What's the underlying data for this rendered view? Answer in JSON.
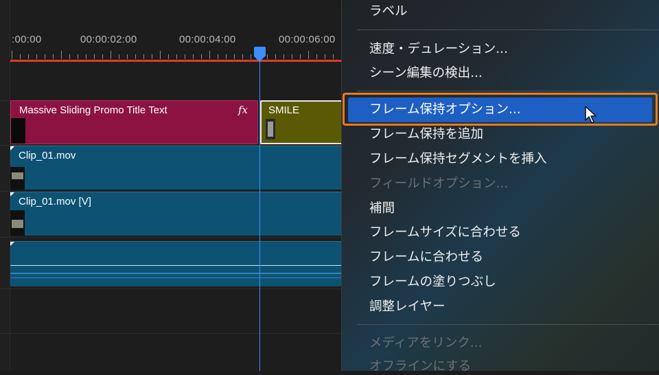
{
  "timeline": {
    "ruler_timecodes": [
      ":00:00",
      "00:00:02:00",
      "00:00:04:00",
      "00:00:06:00"
    ],
    "clips": {
      "graphic_title": "Massive Sliding Promo Title Text",
      "graphic_fx": "fx",
      "smile_title": "SMILE",
      "video1_title": "Clip_01.mov",
      "video2_title": "Clip_01.mov [V]"
    }
  },
  "context_menu": {
    "items": [
      {
        "label": "ラベル",
        "enabled": true
      },
      {
        "label": "速度・デュレーション...",
        "enabled": true
      },
      {
        "label": "シーン編集の検出...",
        "enabled": true
      },
      {
        "label": "フレーム保持オプション...",
        "enabled": true,
        "selected": true
      },
      {
        "label": "フレーム保持を追加",
        "enabled": true
      },
      {
        "label": "フレーム保持セグメントを挿入",
        "enabled": true
      },
      {
        "label": "フィールドオプション...",
        "enabled": false
      },
      {
        "label": "補間",
        "enabled": true
      },
      {
        "label": "フレームサイズに合わせる",
        "enabled": true
      },
      {
        "label": "フレームに合わせる",
        "enabled": true
      },
      {
        "label": "フレームの塗りつぶし",
        "enabled": true
      },
      {
        "label": "調整レイヤー",
        "enabled": true
      },
      {
        "label": "メディアをリンク...",
        "enabled": false
      },
      {
        "label": "オフラインにする",
        "enabled": false
      }
    ]
  },
  "colors": {
    "playhead": "#3d8ef7",
    "workarea": "#e0392e",
    "graphic_clip": "#8c1341",
    "smile_clip": "#5a5a05",
    "video_clip": "#0e5273",
    "menu_selected": "#1e5fc4",
    "highlight_outline": "#f07a1a"
  },
  "icons": [
    "fx-badge-icon",
    "mouse-pointer-icon",
    "playhead-icon"
  ]
}
